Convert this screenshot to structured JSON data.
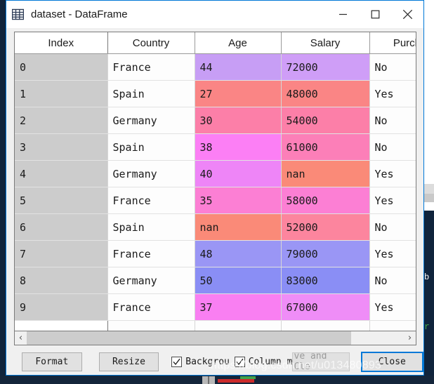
{
  "window": {
    "title": "dataset - DataFrame",
    "icon": "table-grid-icon",
    "minimize_label": "─",
    "maximize_label": "□",
    "close_label": "✕"
  },
  "table": {
    "columns": [
      "Index",
      "Country",
      "Age",
      "Salary",
      "Purch."
    ],
    "rows": [
      {
        "index": "0",
        "country": "France",
        "age": "44",
        "salary": "72000",
        "purchased": "No",
        "age_color": "#c79ef5",
        "salary_color": "#cf9ef7"
      },
      {
        "index": "1",
        "country": "Spain",
        "age": "27",
        "salary": "48000",
        "purchased": "Yes",
        "age_color": "#fa8585",
        "salary_color": "#fa8585"
      },
      {
        "index": "2",
        "country": "Germany",
        "age": "30",
        "salary": "54000",
        "purchased": "No",
        "age_color": "#fc7fa8",
        "salary_color": "#fc7fa8"
      },
      {
        "index": "3",
        "country": "Spain",
        "age": "38",
        "salary": "61000",
        "purchased": "No",
        "age_color": "#fc7ff5",
        "salary_color": "#fc7fb8"
      },
      {
        "index": "4",
        "country": "Germany",
        "age": "40",
        "salary": "nan",
        "purchased": "Yes",
        "age_color": "#ee85f7",
        "salary_color": "#fa8a78"
      },
      {
        "index": "5",
        "country": "France",
        "age": "35",
        "salary": "58000",
        "purchased": "Yes",
        "age_color": "#fc7fd4",
        "salary_color": "#fc7fd4"
      },
      {
        "index": "6",
        "country": "Spain",
        "age": "nan",
        "salary": "52000",
        "purchased": "No",
        "age_color": "#fa8a78",
        "salary_color": "#fc859e"
      },
      {
        "index": "7",
        "country": "France",
        "age": "48",
        "salary": "79000",
        "purchased": "Yes",
        "age_color": "#9a96f5",
        "salary_color": "#9a96f5"
      },
      {
        "index": "8",
        "country": "Germany",
        "age": "50",
        "salary": "83000",
        "purchased": "No",
        "age_color": "#8a8ef5",
        "salary_color": "#8a8ef5"
      },
      {
        "index": "9",
        "country": "France",
        "age": "37",
        "salary": "67000",
        "purchased": "Yes",
        "age_color": "#f97ff2",
        "salary_color": "#ef8df7"
      }
    ]
  },
  "scrollbar": {
    "left_arrow": "‹",
    "right_arrow": "›"
  },
  "toolbar": {
    "format_label": "Format",
    "resize_label": "Resize",
    "background_label": "Backgrou",
    "column_min_label": "Column mı",
    "save_and_close_label": "ve and Clo",
    "close_label": "Close"
  },
  "watermark": {
    "text": "https://blog.csdn.net/u013480893"
  },
  "colors": {
    "accent": "#0078d7",
    "index_cell": "#cccccc",
    "window_bg": "#f0f0f0",
    "button_bg": "#e1e1e1"
  }
}
